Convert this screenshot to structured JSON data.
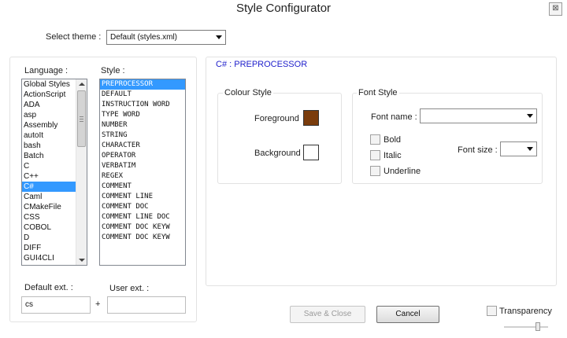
{
  "window": {
    "title": "Style Configurator",
    "close_glyph": "⊠"
  },
  "theme": {
    "label": "Select theme :",
    "value": "Default (styles.xml)"
  },
  "language": {
    "label": "Language :",
    "items": [
      "Global Styles",
      "ActionScript",
      "ADA",
      "asp",
      "Assembly",
      "autoIt",
      "bash",
      "Batch",
      "C",
      "C++",
      "C#",
      "Caml",
      "CMakeFile",
      "CSS",
      "COBOL",
      "D",
      "DIFF",
      "GUI4CLI"
    ],
    "selected_index": 10
  },
  "style": {
    "label": "Style :",
    "items": [
      "PREPROCESSOR",
      "DEFAULT",
      "INSTRUCTION WORD",
      "TYPE WORD",
      "NUMBER",
      "STRING",
      "CHARACTER",
      "OPERATOR",
      "VERBATIM",
      "REGEX",
      "COMMENT",
      "COMMENT LINE",
      "COMMENT DOC",
      "COMMENT LINE DOC",
      "COMMENT DOC KEYW",
      "COMMENT DOC KEYW"
    ],
    "selected_index": 0
  },
  "ext": {
    "default_label": "Default ext. :",
    "default_value": "cs",
    "plus": "+",
    "user_label": "User ext. :",
    "user_value": ""
  },
  "section": {
    "title": "C# : PREPROCESSOR"
  },
  "colour_style": {
    "title": "Colour Style",
    "foreground_label": "Foreground",
    "foreground_color": "#7a3c0c",
    "background_label": "Background",
    "background_color": "#ffffff"
  },
  "font_style": {
    "title": "Font Style",
    "font_name_label": "Font name :",
    "font_name_value": "",
    "font_size_label": "Font size :",
    "font_size_value": "",
    "bold_label": "Bold",
    "italic_label": "Italic",
    "underline_label": "Underline"
  },
  "buttons": {
    "save_close": "Save & Close",
    "cancel": "Cancel"
  },
  "transparency": {
    "label": "Transparency"
  }
}
